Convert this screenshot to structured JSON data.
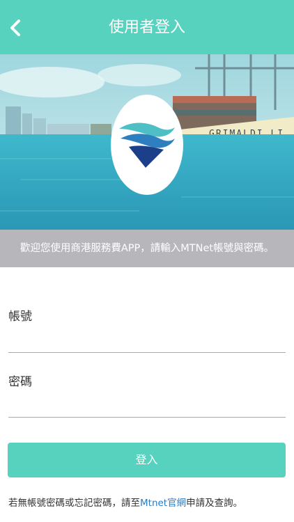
{
  "header": {
    "title": "使用者登入",
    "back_icon": "chevron-left-icon",
    "color": "#56d2bf"
  },
  "hero": {
    "ship_name": "GRIMALDI LI",
    "logo_icon": "mtnet-wave-logo"
  },
  "welcome": {
    "message": "歡迎您使用商港服務費APP，請輸入MTNet帳號與密碼。"
  },
  "form": {
    "account_label": "帳號",
    "account_value": "",
    "password_label": "密碼",
    "password_value": "",
    "submit_label": "登入"
  },
  "footer": {
    "prefix": "若無帳號密碼或忘記密碼，請至",
    "link_text": "Mtnet官網",
    "suffix": "申請及查詢。",
    "link_color": "#2a7dc4"
  }
}
